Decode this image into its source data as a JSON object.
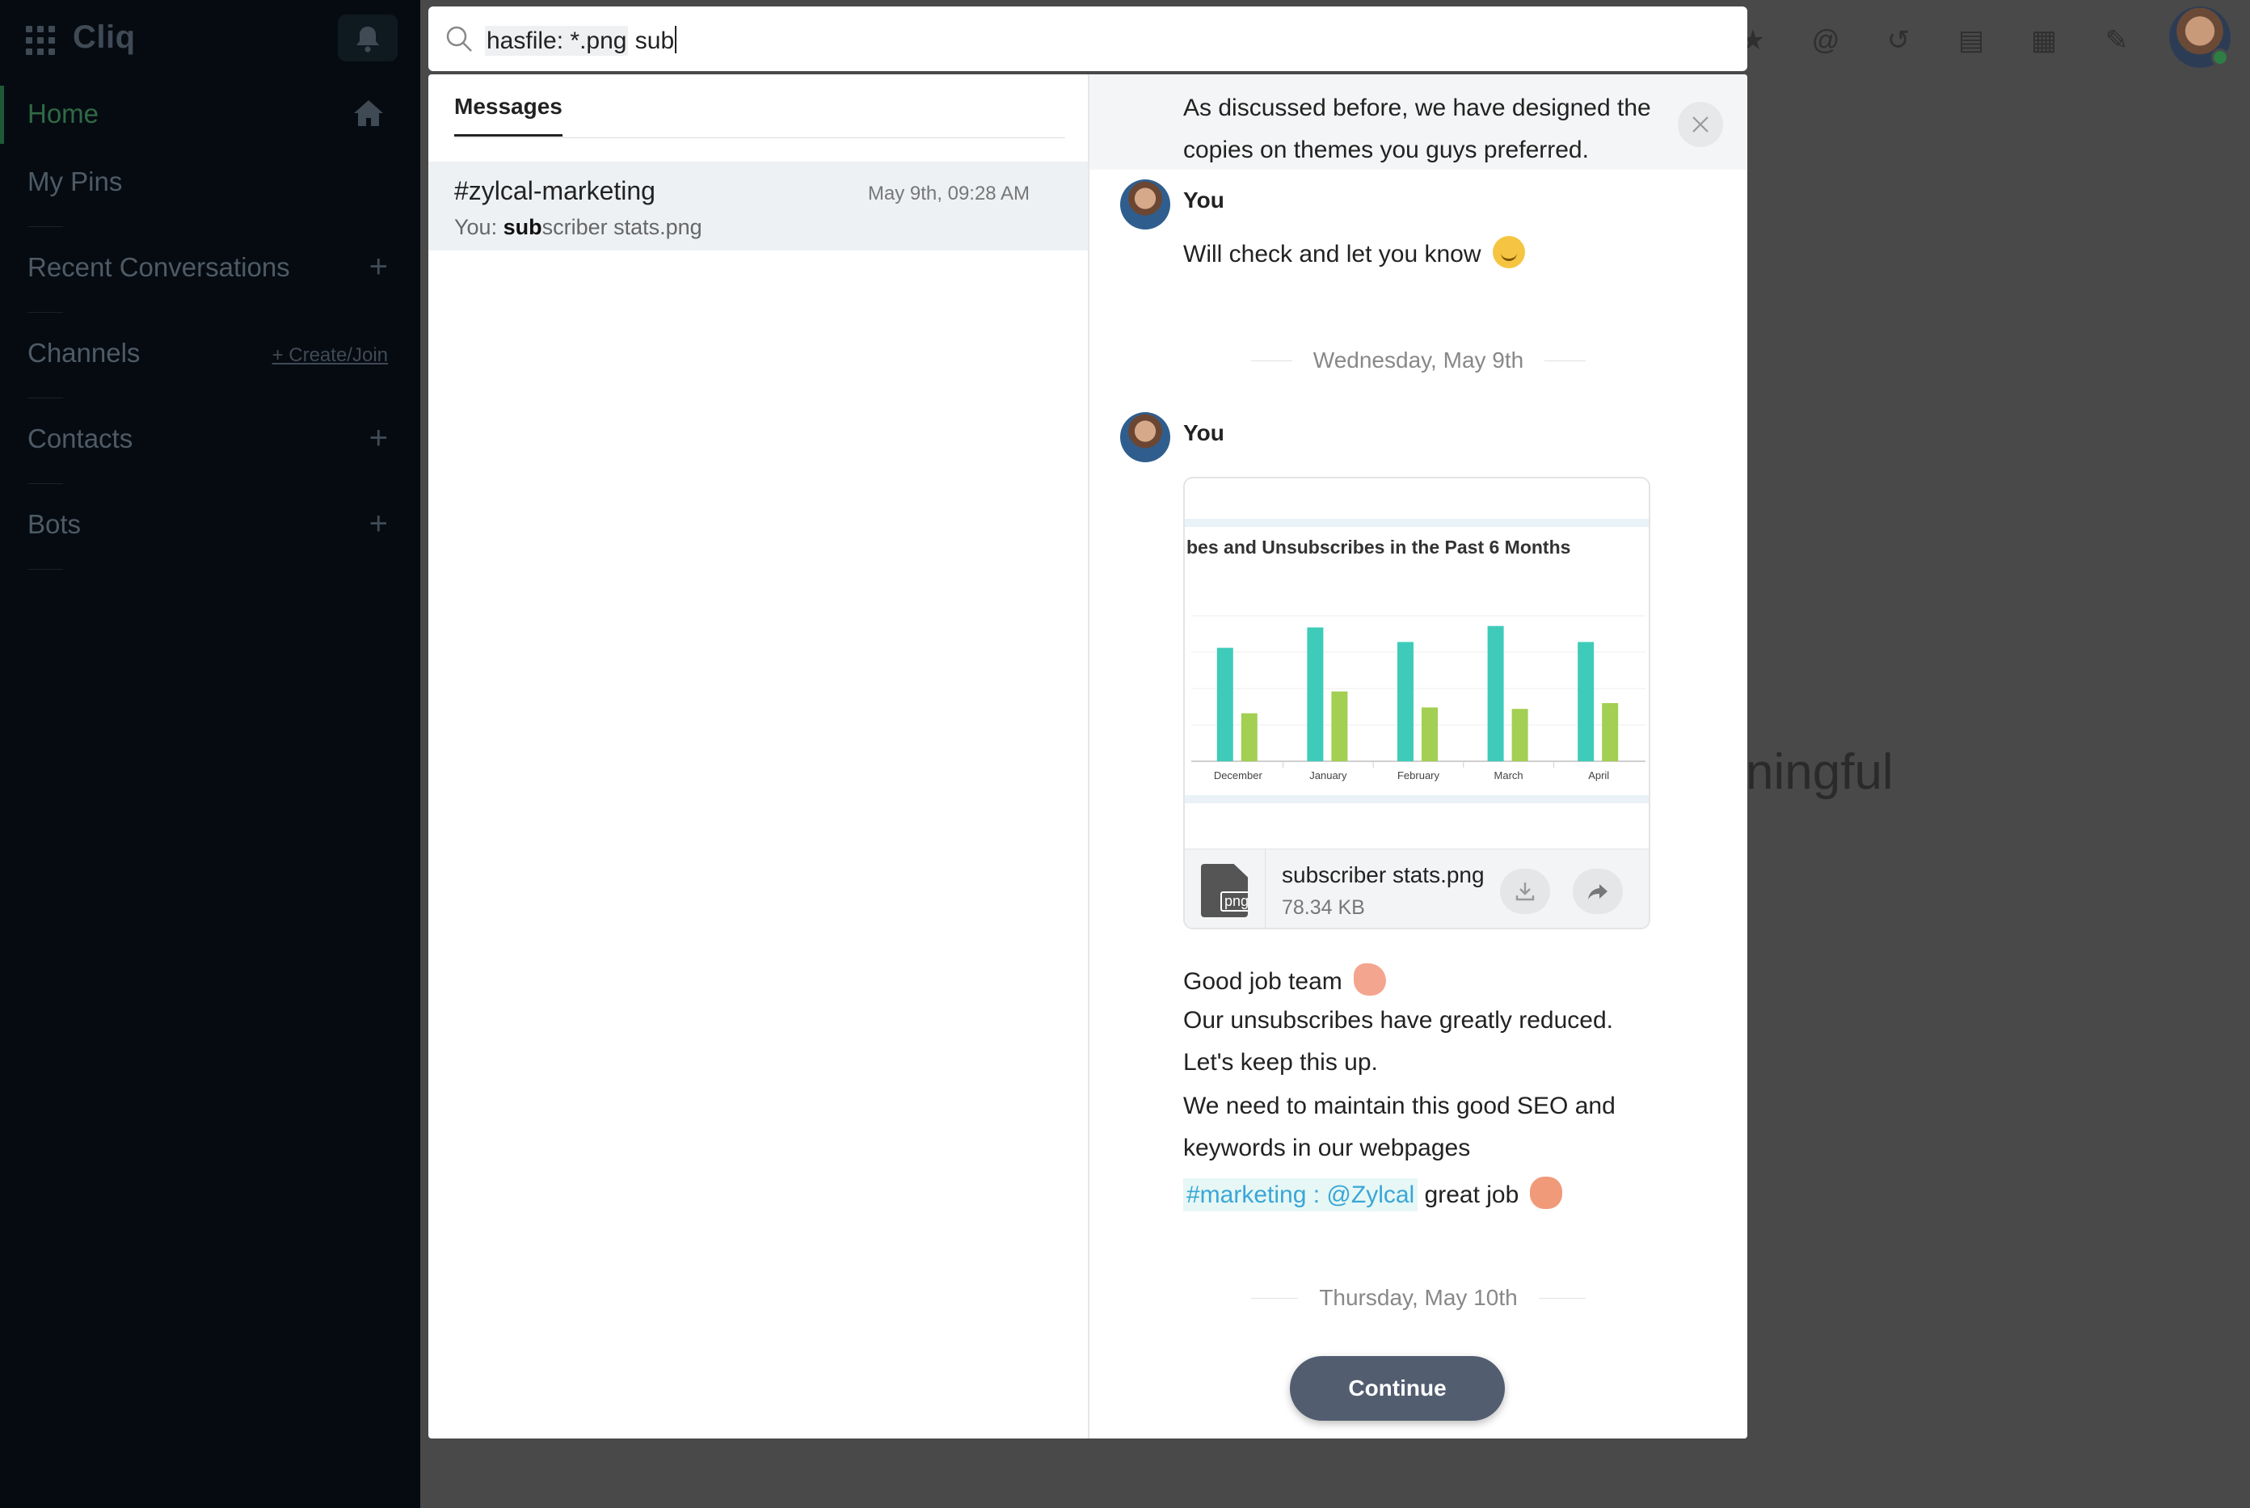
{
  "sidebar": {
    "brand": "Cliq",
    "items": [
      {
        "label": "Home"
      },
      {
        "label": "My Pins"
      },
      {
        "label": "Recent Conversations"
      },
      {
        "label": "Channels",
        "action": "+ Create/Join"
      },
      {
        "label": "Contacts"
      },
      {
        "label": "Bots"
      }
    ]
  },
  "background": {
    "partial_text": "ningful"
  },
  "search": {
    "query_token": "hasfile: *.png",
    "query_rest": " sub"
  },
  "results": {
    "tab_label": "Messages",
    "items": [
      {
        "channel": "#zylcal-marketing",
        "prefix": "You: ",
        "highlight": "sub",
        "rest": "scriber stats.png",
        "date": "May 9th, 09:28 AM"
      }
    ]
  },
  "preview": {
    "head_text": "As discussed before, we have designed the copies on themes you guys preferred.",
    "msg1": {
      "sender": "You",
      "text": "Will check and let you know"
    },
    "date1": "Wednesday, May 9th",
    "msg2": {
      "sender": "You"
    },
    "attachment": {
      "chart_title": "bes and Unsubscribes in the Past 6 Months",
      "file_name": "subscriber stats.png",
      "file_size": "78.34 KB",
      "file_badge": "png"
    },
    "lines": [
      "Good job team",
      "Our unsubscribes have greatly reduced.",
      "Let's keep this up.",
      "We need to maintain this good SEO and",
      "keywords in our webpages"
    ],
    "hashtag": "#marketing : @Zylcal",
    "hashtag_after": "great job",
    "date2": "Thursday, May 10th",
    "continue_label": "Continue"
  },
  "chart_data": {
    "type": "bar",
    "title": "bes and Unsubscribes in the Past 6 Months",
    "categories": [
      "December",
      "January",
      "February",
      "March",
      "April"
    ],
    "series": [
      {
        "values": [
          78,
          92,
          82,
          93,
          82
        ]
      },
      {
        "values": [
          33,
          48,
          37,
          36,
          40
        ]
      }
    ],
    "colors": [
      "#3fcbb9",
      "#a3cf52"
    ]
  }
}
